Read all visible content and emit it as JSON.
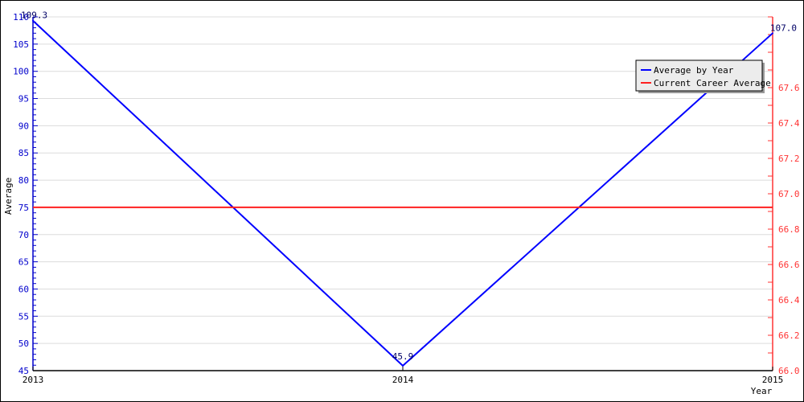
{
  "chart_data": {
    "type": "line",
    "title": "",
    "xlabel": "Year",
    "ylabel": "Average",
    "categories": [
      "2013",
      "2014",
      "2015"
    ],
    "series": [
      {
        "name": "Average by Year",
        "axis": "left",
        "color": "#0000ff",
        "values": [
          109.3,
          45.9,
          107.0
        ],
        "data_labels": [
          "109.3",
          "45.9",
          "107.0"
        ]
      },
      {
        "name": "Current Career Average",
        "axis": "left",
        "color": "#ff2020",
        "values": [
          75.0,
          75.0,
          75.0
        ]
      }
    ],
    "y_left": {
      "min": 45,
      "max": 110,
      "major_step": 5,
      "minor_step": 1,
      "color": "#0000cc",
      "tick_labels": [
        "45",
        "50",
        "55",
        "60",
        "65",
        "70",
        "75",
        "80",
        "85",
        "90",
        "95",
        "100",
        "105",
        "110"
      ]
    },
    "y_right": {
      "min": 66.0,
      "max": 68.0,
      "major_step": 0.2,
      "color": "#ff3333",
      "tick_labels": [
        "66.0",
        "66.2",
        "66.4",
        "66.6",
        "66.8",
        "67.0",
        "67.2",
        "67.4",
        "67.6"
      ]
    },
    "grid": true,
    "legend": {
      "position": "top-right",
      "entries": [
        "Average by Year",
        "Current Career Average"
      ]
    }
  }
}
